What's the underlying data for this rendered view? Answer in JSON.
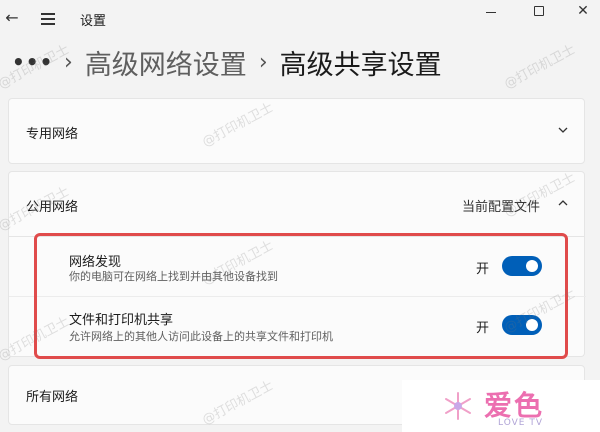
{
  "window": {
    "title": "设置",
    "back_icon": "back-arrow-icon",
    "menu_icon": "hamburger-menu-icon"
  },
  "breadcrumb": {
    "dots": "•••",
    "parent": "高级网络设置",
    "current": "高级共享设置"
  },
  "sections": {
    "private": {
      "label": "专用网络"
    },
    "public": {
      "label": "公用网络",
      "status": "当前配置文件",
      "settings": [
        {
          "title": "网络发现",
          "description": "你的电脑可在网络上找到并由其他设备找到",
          "state": "开",
          "on": true
        },
        {
          "title": "文件和打印机共享",
          "description": "允许网络上的其他人访问此设备上的共享文件和打印机",
          "state": "开",
          "on": true
        }
      ]
    },
    "all": {
      "label": "所有网络"
    }
  },
  "watermark": "@打印机卫士",
  "logo": {
    "name": "爱色",
    "sub": "LOVE TV"
  },
  "colors": {
    "accent": "#005fb8",
    "highlight": "#e04b4b",
    "logo": "#ec6fb0"
  }
}
